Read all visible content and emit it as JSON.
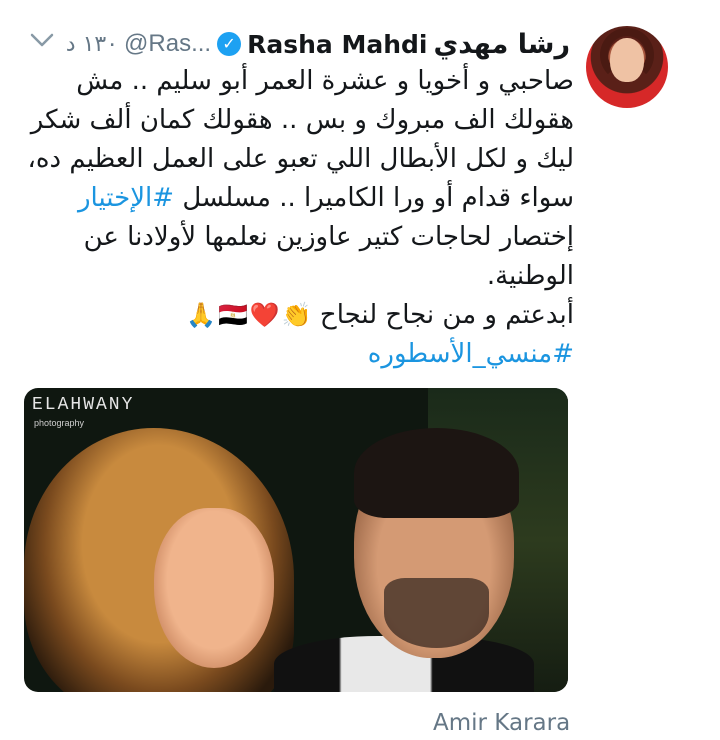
{
  "author": {
    "name_arabic": "رشا مهدي",
    "name_latin": "Rasha Mahdi",
    "handle": "@Ras...",
    "verified": true,
    "time": "١٣٠ د"
  },
  "tweet": {
    "lines": [
      "صاحبي و أخويا و عشرة العمر أبو سليم .. مش",
      "هقولك الف مبروك و بس .. هقولك كمان ألف شكر",
      "ليك و لكل الأبطال اللي تعبو على العمل العظيم ده،"
    ],
    "line4_text": "سواء قدام أو ورا الكاميرا .. مسلسل",
    "line4_hashtag": "#الإختيار",
    "line5": "إختصار لحاجات كتير عاوزين نعلمها لأولادنا عن",
    "line6": "الوطنية.",
    "line7_text": "أبدعتم و من نجاح لنجاح",
    "line7_emojis": [
      "👏",
      "❤️",
      "🇪🇬",
      "🙏"
    ],
    "hashtag_line": "#منسي_الأسطوره"
  },
  "media": {
    "watermark": "ELAHWANY",
    "watermark_sub": "photography"
  },
  "tagged_person": "Amir Karara",
  "colors": {
    "link": "#1b95e0",
    "secondary": "#657786",
    "verified": "#1da1f2"
  }
}
